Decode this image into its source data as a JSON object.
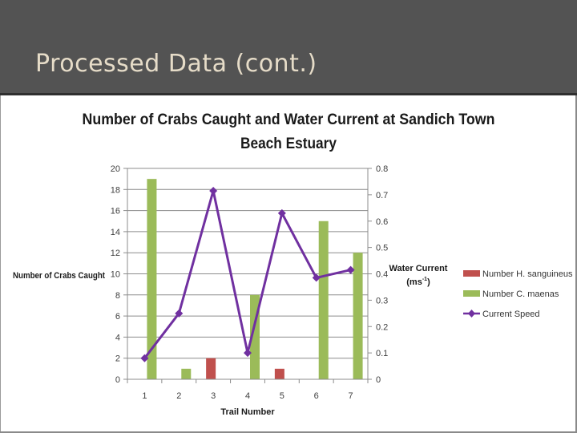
{
  "slide": {
    "title": "Processed Data (cont.)"
  },
  "colors": {
    "header_bg": "#535353",
    "title_text": "#e6dcc8",
    "h_sanguineus": "#c0504d",
    "c_maenas": "#9bbb59",
    "current_speed": "#7030a0",
    "gridline": "#8c8c8c"
  },
  "chart_data": {
    "type": "bar",
    "combo_with": "line",
    "title": "Number of Crabs Caught and Water Current at Sandich Town Beach Estuary",
    "title_lines": [
      "Number of Crabs Caught and Water Current at Sandich Town",
      "Beach Estuary"
    ],
    "xlabel": "Trail Number",
    "ylabel": "Number of Crabs Caught",
    "y2label": "Water Current",
    "y2label_unit": "(ms",
    "y2label_sup": "-1",
    "y2label_close": ")",
    "categories": [
      "1",
      "2",
      "3",
      "4",
      "5",
      "6",
      "7"
    ],
    "ylim": [
      0,
      20
    ],
    "y_ticks": [
      "0",
      "2",
      "4",
      "6",
      "8",
      "10",
      "12",
      "14",
      "16",
      "18",
      "20"
    ],
    "y_tick_values": [
      0,
      2,
      4,
      6,
      8,
      10,
      12,
      14,
      16,
      18,
      20
    ],
    "y2lim": [
      0,
      0.8
    ],
    "y2_ticks": [
      "0",
      "0.1",
      "0.2",
      "0.3",
      "0.4",
      "0.5",
      "0.6",
      "0.7",
      "0.8"
    ],
    "y2_tick_values": [
      0,
      0.1,
      0.2,
      0.3,
      0.4,
      0.5,
      0.6,
      0.7,
      0.8
    ],
    "grid": true,
    "legend_position": "right",
    "series": [
      {
        "name": "Number H. sanguineus",
        "type": "bar",
        "axis": "left",
        "values": [
          0,
          0,
          2,
          0,
          1,
          0,
          0
        ]
      },
      {
        "name": "Number C. maenas",
        "type": "bar",
        "axis": "left",
        "values": [
          19,
          1,
          0,
          8,
          0,
          15,
          12
        ]
      },
      {
        "name": "Current Speed",
        "type": "line",
        "axis": "right",
        "marker": "diamond",
        "values": [
          0.08,
          0.25,
          0.715,
          0.1,
          0.63,
          0.385,
          0.415
        ]
      }
    ]
  }
}
